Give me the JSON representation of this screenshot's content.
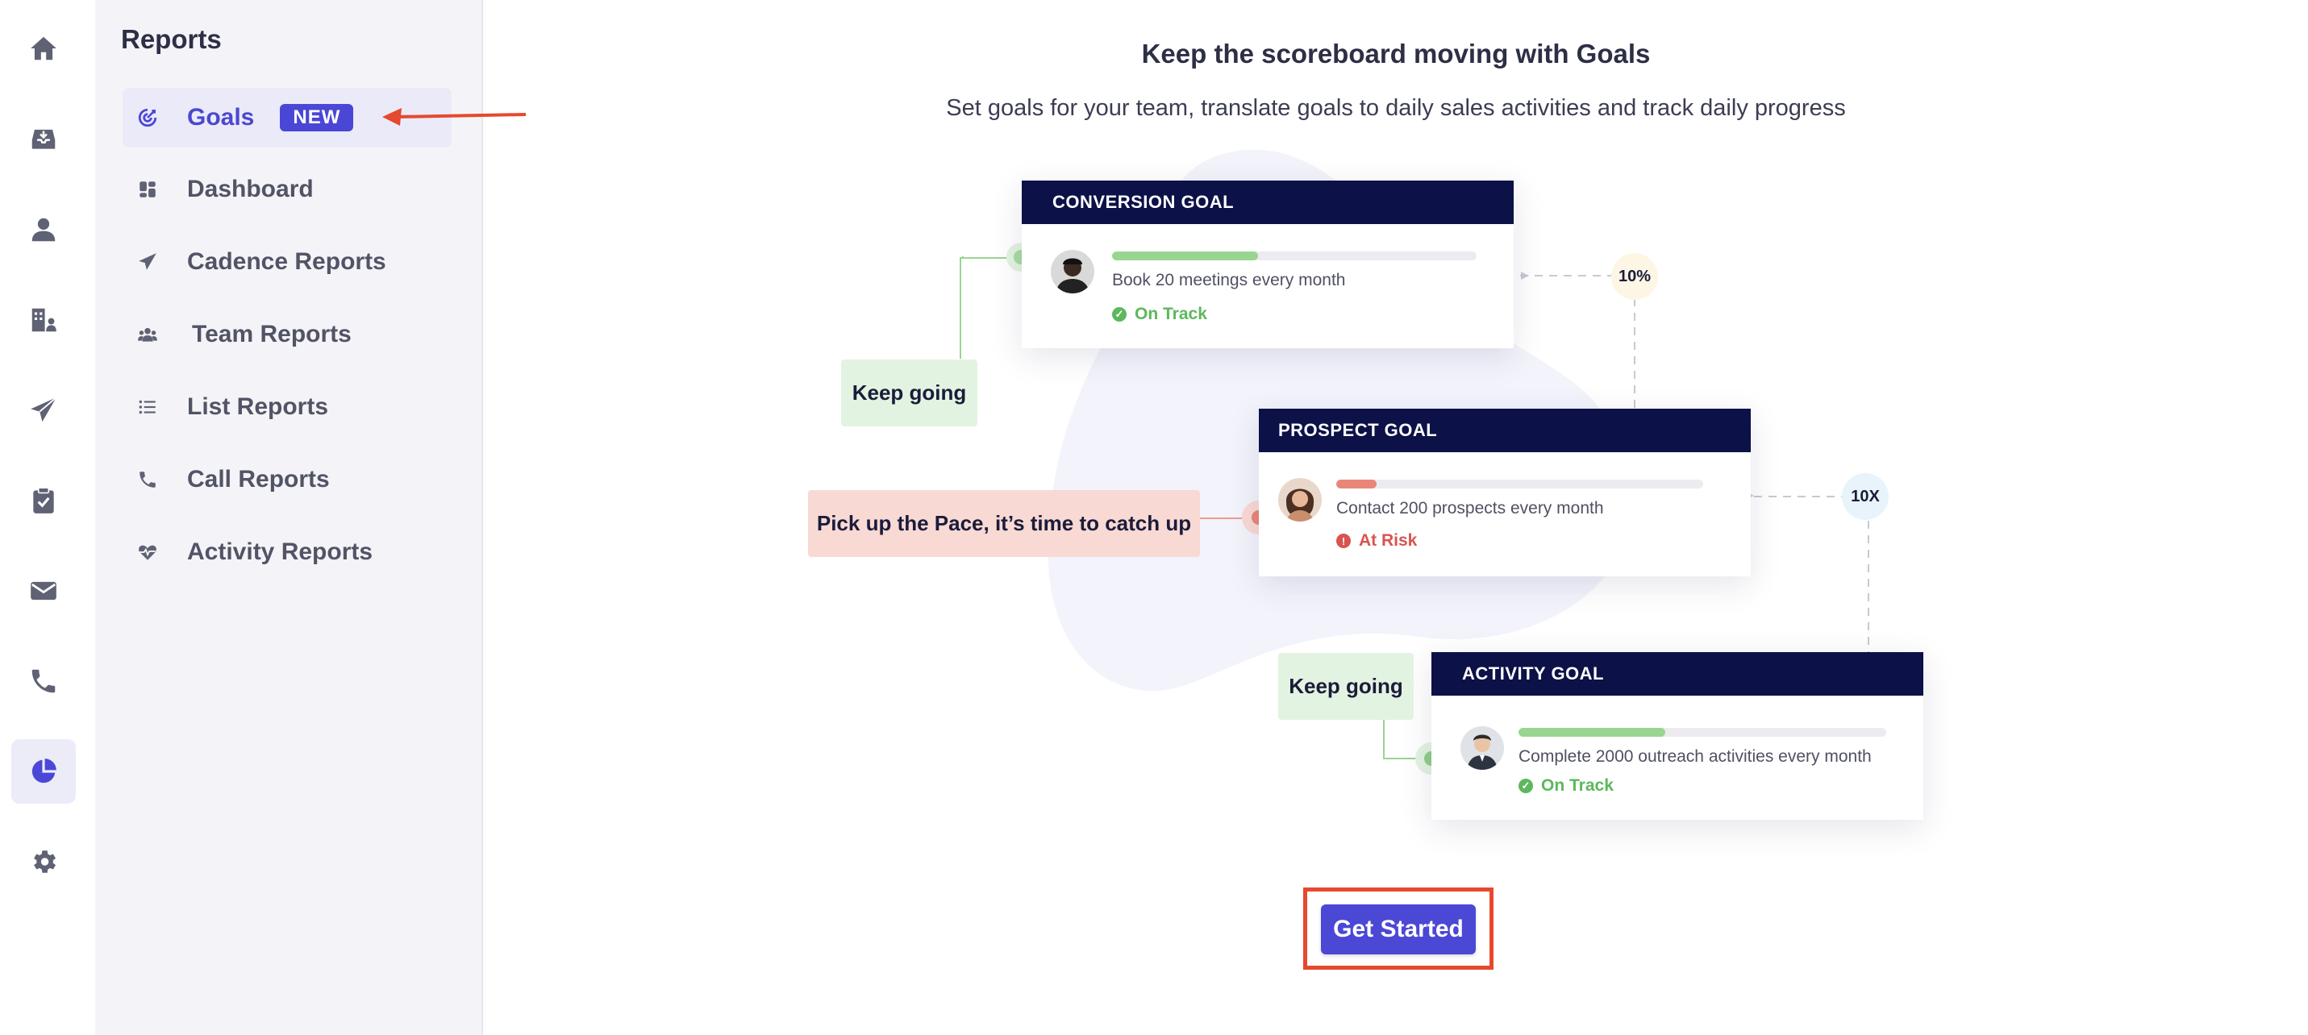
{
  "rail": {
    "items": [
      {
        "name": "home-icon"
      },
      {
        "name": "inbox-icon"
      },
      {
        "name": "user-icon"
      },
      {
        "name": "accounts-icon"
      },
      {
        "name": "send-icon"
      },
      {
        "name": "clipboard-check-icon"
      },
      {
        "name": "mail-icon"
      },
      {
        "name": "phone-icon"
      },
      {
        "name": "pie-chart-icon",
        "active": true
      },
      {
        "name": "settings-icon"
      }
    ]
  },
  "sidebar": {
    "title": "Reports",
    "items": [
      {
        "label": "Goals",
        "icon": "target-icon",
        "badge": "NEW",
        "active": true
      },
      {
        "label": "Dashboard",
        "icon": "dashboard-icon"
      },
      {
        "label": "Cadence Reports",
        "icon": "send-icon"
      },
      {
        "label": "Team Reports",
        "icon": "team-icon"
      },
      {
        "label": "List Reports",
        "icon": "list-icon"
      },
      {
        "label": "Call Reports",
        "icon": "phone-icon"
      },
      {
        "label": "Activity Reports",
        "icon": "heartbeat-icon"
      }
    ]
  },
  "main": {
    "heading": "Keep the scoreboard moving with Goals",
    "subheading": "Set goals for your team, translate goals to daily sales activities and track daily progress",
    "cards": [
      {
        "title": "CONVERSION GOAL",
        "text": "Book 20 meetings every month",
        "status": "On Track",
        "progress": 0.4
      },
      {
        "title": "PROSPECT GOAL",
        "text": "Contact 200 prospects every month",
        "status": "At Risk",
        "progress": 0.11
      },
      {
        "title": "ACTIVITY GOAL",
        "text": "Complete 2000 outreach activities every month",
        "status": "On Track",
        "progress": 0.4
      }
    ],
    "callouts": {
      "keep_going_1": "Keep going",
      "pick_up": "Pick up the Pace, it’s time to catch up",
      "keep_going_2": "Keep going"
    },
    "multipliers": {
      "conversion": "10%",
      "prospect": "10X"
    },
    "cta": "Get Started"
  },
  "colors": {
    "brand": "#4b48d6",
    "card_header": "#0c1147",
    "on_track": "#5cb85c",
    "at_risk": "#d9534f",
    "annotation": "#e5492e"
  }
}
